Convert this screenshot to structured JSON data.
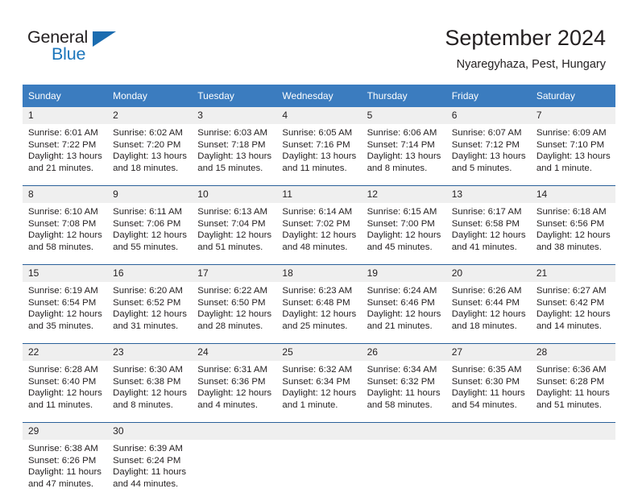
{
  "brand": {
    "name_part1": "General",
    "name_part2": "Blue",
    "flag_icon": "triangle-flag-icon"
  },
  "header": {
    "title": "September 2024",
    "location": "Nyaregyhaza, Pest, Hungary"
  },
  "calendar": {
    "weekday_headers": [
      "Sunday",
      "Monday",
      "Tuesday",
      "Wednesday",
      "Thursday",
      "Friday",
      "Saturday"
    ],
    "colors": {
      "header_blue": "#3b7cbf",
      "row_divider_blue": "#2a6099",
      "daynum_band_gray": "#efefef",
      "brand_blue": "#1b75bb",
      "text": "#231f20"
    },
    "labels": {
      "sunrise": "Sunrise:",
      "sunset": "Sunset:",
      "daylight": "Daylight:"
    },
    "weeks": [
      [
        {
          "day": "1",
          "sunrise": "Sunrise: 6:01 AM",
          "sunset": "Sunset: 7:22 PM",
          "daylight_line1": "Daylight: 13 hours",
          "daylight_line2": "and 21 minutes."
        },
        {
          "day": "2",
          "sunrise": "Sunrise: 6:02 AM",
          "sunset": "Sunset: 7:20 PM",
          "daylight_line1": "Daylight: 13 hours",
          "daylight_line2": "and 18 minutes."
        },
        {
          "day": "3",
          "sunrise": "Sunrise: 6:03 AM",
          "sunset": "Sunset: 7:18 PM",
          "daylight_line1": "Daylight: 13 hours",
          "daylight_line2": "and 15 minutes."
        },
        {
          "day": "4",
          "sunrise": "Sunrise: 6:05 AM",
          "sunset": "Sunset: 7:16 PM",
          "daylight_line1": "Daylight: 13 hours",
          "daylight_line2": "and 11 minutes."
        },
        {
          "day": "5",
          "sunrise": "Sunrise: 6:06 AM",
          "sunset": "Sunset: 7:14 PM",
          "daylight_line1": "Daylight: 13 hours",
          "daylight_line2": "and 8 minutes."
        },
        {
          "day": "6",
          "sunrise": "Sunrise: 6:07 AM",
          "sunset": "Sunset: 7:12 PM",
          "daylight_line1": "Daylight: 13 hours",
          "daylight_line2": "and 5 minutes."
        },
        {
          "day": "7",
          "sunrise": "Sunrise: 6:09 AM",
          "sunset": "Sunset: 7:10 PM",
          "daylight_line1": "Daylight: 13 hours",
          "daylight_line2": "and 1 minute."
        }
      ],
      [
        {
          "day": "8",
          "sunrise": "Sunrise: 6:10 AM",
          "sunset": "Sunset: 7:08 PM",
          "daylight_line1": "Daylight: 12 hours",
          "daylight_line2": "and 58 minutes."
        },
        {
          "day": "9",
          "sunrise": "Sunrise: 6:11 AM",
          "sunset": "Sunset: 7:06 PM",
          "daylight_line1": "Daylight: 12 hours",
          "daylight_line2": "and 55 minutes."
        },
        {
          "day": "10",
          "sunrise": "Sunrise: 6:13 AM",
          "sunset": "Sunset: 7:04 PM",
          "daylight_line1": "Daylight: 12 hours",
          "daylight_line2": "and 51 minutes."
        },
        {
          "day": "11",
          "sunrise": "Sunrise: 6:14 AM",
          "sunset": "Sunset: 7:02 PM",
          "daylight_line1": "Daylight: 12 hours",
          "daylight_line2": "and 48 minutes."
        },
        {
          "day": "12",
          "sunrise": "Sunrise: 6:15 AM",
          "sunset": "Sunset: 7:00 PM",
          "daylight_line1": "Daylight: 12 hours",
          "daylight_line2": "and 45 minutes."
        },
        {
          "day": "13",
          "sunrise": "Sunrise: 6:17 AM",
          "sunset": "Sunset: 6:58 PM",
          "daylight_line1": "Daylight: 12 hours",
          "daylight_line2": "and 41 minutes."
        },
        {
          "day": "14",
          "sunrise": "Sunrise: 6:18 AM",
          "sunset": "Sunset: 6:56 PM",
          "daylight_line1": "Daylight: 12 hours",
          "daylight_line2": "and 38 minutes."
        }
      ],
      [
        {
          "day": "15",
          "sunrise": "Sunrise: 6:19 AM",
          "sunset": "Sunset: 6:54 PM",
          "daylight_line1": "Daylight: 12 hours",
          "daylight_line2": "and 35 minutes."
        },
        {
          "day": "16",
          "sunrise": "Sunrise: 6:20 AM",
          "sunset": "Sunset: 6:52 PM",
          "daylight_line1": "Daylight: 12 hours",
          "daylight_line2": "and 31 minutes."
        },
        {
          "day": "17",
          "sunrise": "Sunrise: 6:22 AM",
          "sunset": "Sunset: 6:50 PM",
          "daylight_line1": "Daylight: 12 hours",
          "daylight_line2": "and 28 minutes."
        },
        {
          "day": "18",
          "sunrise": "Sunrise: 6:23 AM",
          "sunset": "Sunset: 6:48 PM",
          "daylight_line1": "Daylight: 12 hours",
          "daylight_line2": "and 25 minutes."
        },
        {
          "day": "19",
          "sunrise": "Sunrise: 6:24 AM",
          "sunset": "Sunset: 6:46 PM",
          "daylight_line1": "Daylight: 12 hours",
          "daylight_line2": "and 21 minutes."
        },
        {
          "day": "20",
          "sunrise": "Sunrise: 6:26 AM",
          "sunset": "Sunset: 6:44 PM",
          "daylight_line1": "Daylight: 12 hours",
          "daylight_line2": "and 18 minutes."
        },
        {
          "day": "21",
          "sunrise": "Sunrise: 6:27 AM",
          "sunset": "Sunset: 6:42 PM",
          "daylight_line1": "Daylight: 12 hours",
          "daylight_line2": "and 14 minutes."
        }
      ],
      [
        {
          "day": "22",
          "sunrise": "Sunrise: 6:28 AM",
          "sunset": "Sunset: 6:40 PM",
          "daylight_line1": "Daylight: 12 hours",
          "daylight_line2": "and 11 minutes."
        },
        {
          "day": "23",
          "sunrise": "Sunrise: 6:30 AM",
          "sunset": "Sunset: 6:38 PM",
          "daylight_line1": "Daylight: 12 hours",
          "daylight_line2": "and 8 minutes."
        },
        {
          "day": "24",
          "sunrise": "Sunrise: 6:31 AM",
          "sunset": "Sunset: 6:36 PM",
          "daylight_line1": "Daylight: 12 hours",
          "daylight_line2": "and 4 minutes."
        },
        {
          "day": "25",
          "sunrise": "Sunrise: 6:32 AM",
          "sunset": "Sunset: 6:34 PM",
          "daylight_line1": "Daylight: 12 hours",
          "daylight_line2": "and 1 minute."
        },
        {
          "day": "26",
          "sunrise": "Sunrise: 6:34 AM",
          "sunset": "Sunset: 6:32 PM",
          "daylight_line1": "Daylight: 11 hours",
          "daylight_line2": "and 58 minutes."
        },
        {
          "day": "27",
          "sunrise": "Sunrise: 6:35 AM",
          "sunset": "Sunset: 6:30 PM",
          "daylight_line1": "Daylight: 11 hours",
          "daylight_line2": "and 54 minutes."
        },
        {
          "day": "28",
          "sunrise": "Sunrise: 6:36 AM",
          "sunset": "Sunset: 6:28 PM",
          "daylight_line1": "Daylight: 11 hours",
          "daylight_line2": "and 51 minutes."
        }
      ],
      [
        {
          "day": "29",
          "sunrise": "Sunrise: 6:38 AM",
          "sunset": "Sunset: 6:26 PM",
          "daylight_line1": "Daylight: 11 hours",
          "daylight_line2": "and 47 minutes."
        },
        {
          "day": "30",
          "sunrise": "Sunrise: 6:39 AM",
          "sunset": "Sunset: 6:24 PM",
          "daylight_line1": "Daylight: 11 hours",
          "daylight_line2": "and 44 minutes."
        },
        {
          "day": "",
          "sunrise": "",
          "sunset": "",
          "daylight_line1": "",
          "daylight_line2": ""
        },
        {
          "day": "",
          "sunrise": "",
          "sunset": "",
          "daylight_line1": "",
          "daylight_line2": ""
        },
        {
          "day": "",
          "sunrise": "",
          "sunset": "",
          "daylight_line1": "",
          "daylight_line2": ""
        },
        {
          "day": "",
          "sunrise": "",
          "sunset": "",
          "daylight_line1": "",
          "daylight_line2": ""
        },
        {
          "day": "",
          "sunrise": "",
          "sunset": "",
          "daylight_line1": "",
          "daylight_line2": ""
        }
      ]
    ]
  }
}
